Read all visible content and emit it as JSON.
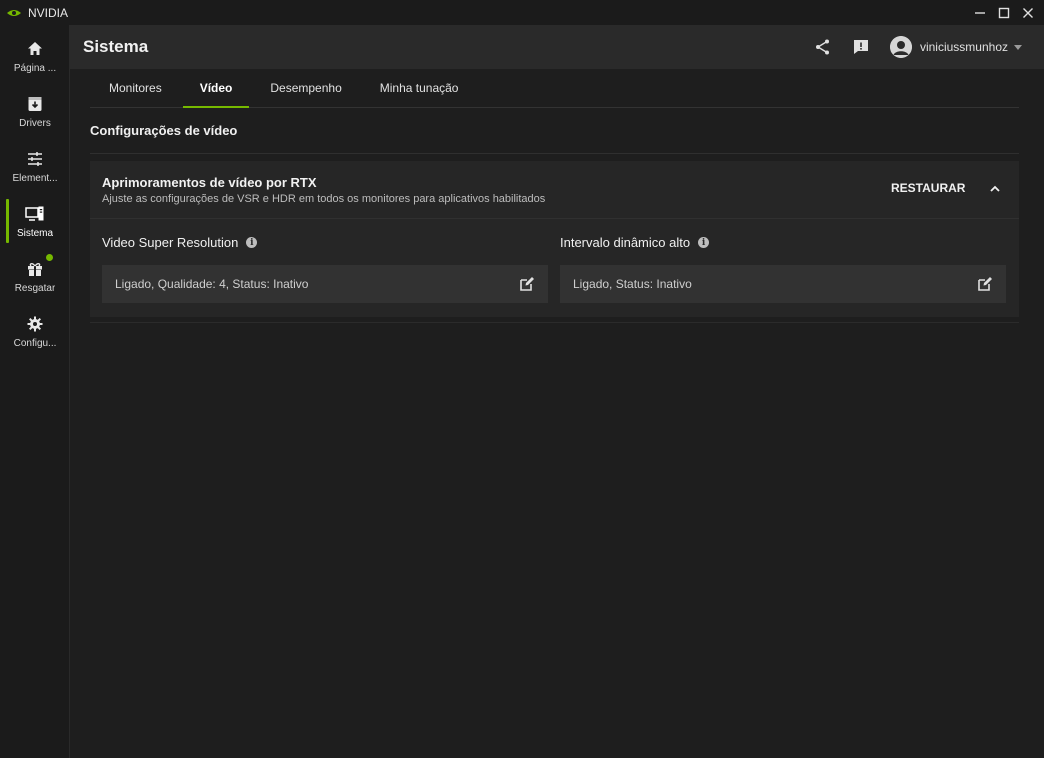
{
  "app": {
    "name": "NVIDIA",
    "accent": "#76b900"
  },
  "sidebar": {
    "items": [
      {
        "label": "Página ...",
        "icon": "home-icon"
      },
      {
        "label": "Drivers",
        "icon": "download-icon"
      },
      {
        "label": "Element...",
        "icon": "sliders-icon"
      },
      {
        "label": "Sistema",
        "icon": "monitor-icon",
        "active": true
      },
      {
        "label": "Resgatar",
        "icon": "gift-icon"
      },
      {
        "label": "Configu...",
        "icon": "gear-icon"
      }
    ]
  },
  "header": {
    "title": "Sistema",
    "username": "viniciussmunhoz"
  },
  "tabs": [
    "Monitores",
    "Vídeo",
    "Desempenho",
    "Minha tunação"
  ],
  "main": {
    "section_title": "Configurações de vídeo",
    "card": {
      "title": "Aprimoramentos de vídeo por RTX",
      "subtitle": "Ajuste as configurações de VSR e HDR em todos os monitores para aplicativos habilitados",
      "restore_label": "RESTAURAR",
      "features": [
        {
          "label": "Video Super Resolution",
          "value": "Ligado, Qualidade: 4, Status: Inativo"
        },
        {
          "label": "Intervalo dinâmico alto",
          "value": "Ligado, Status: Inativo"
        }
      ]
    }
  }
}
